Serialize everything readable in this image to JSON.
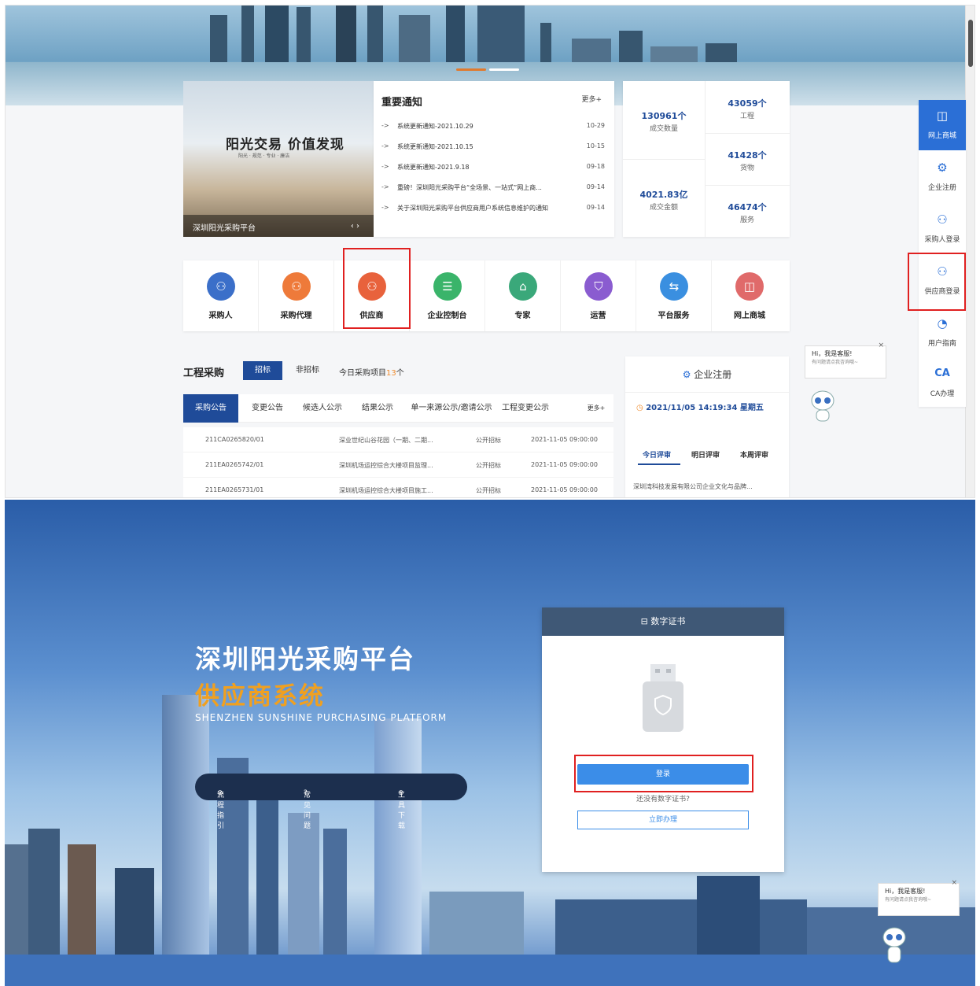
{
  "banner": {
    "dots": [
      "#e07a2e",
      "#ffffff"
    ]
  },
  "slide": {
    "title": "阳光交易 价值发现",
    "subtitle": "阳光 · 规范 · 专业 · 廉洁",
    "caption": "深圳阳光采购平台",
    "nav": "‹ ›"
  },
  "notice": {
    "title": "重要通知",
    "more": "更多+",
    "items": [
      {
        "arrow": "->",
        "text": "系统更新通知-2021.10.29",
        "date": "10-29"
      },
      {
        "arrow": "->",
        "text": "系统更新通知-2021.10.15",
        "date": "10-15"
      },
      {
        "arrow": "->",
        "text": "系统更新通知-2021.9.18",
        "date": "09-18"
      },
      {
        "arrow": "->",
        "text": "重磅！深圳阳光采购平台“全场景、一站式”网上商...",
        "date": "09-14"
      },
      {
        "arrow": "->",
        "text": "关于深圳阳光采购平台供应商用户系统信息维护的通知",
        "date": "09-14"
      }
    ]
  },
  "stats": {
    "deals": {
      "value": "130961个",
      "label": "成交数量"
    },
    "amount": {
      "value": "4021.83亿",
      "label": "成交金额"
    },
    "projects": {
      "value": "43059个",
      "label": "工程"
    },
    "goods": {
      "value": "41428个",
      "label": "货物"
    },
    "services": {
      "value": "46474个",
      "label": "服务"
    }
  },
  "quick": [
    {
      "label": "采购人",
      "color": "#3b6fc9",
      "glyph": "⚇"
    },
    {
      "label": "采购代理",
      "color": "#ee7a3a",
      "glyph": "⚇"
    },
    {
      "label": "供应商",
      "color": "#e8623c",
      "glyph": "⚇"
    },
    {
      "label": "企业控制台",
      "color": "#3ab46a",
      "glyph": "☰"
    },
    {
      "label": "专家",
      "color": "#3aa87a",
      "glyph": "⌂"
    },
    {
      "label": "运营",
      "color": "#8a5cd0",
      "glyph": "⛉"
    },
    {
      "label": "平台服务",
      "color": "#3a8fe0",
      "glyph": "⇆"
    },
    {
      "label": "网上商城",
      "color": "#e06a6a",
      "glyph": "◫"
    }
  ],
  "side": [
    {
      "label": "网上商城",
      "glyph": "◫"
    },
    {
      "label": "企业注册",
      "glyph": "⚙"
    },
    {
      "label": "采购人登录",
      "glyph": "⚇"
    },
    {
      "label": "供应商登录",
      "glyph": "⚇"
    },
    {
      "label": "用户指南",
      "glyph": "◔"
    },
    {
      "label": "CA办理",
      "glyph": "CA"
    }
  ],
  "gc": {
    "title": "工程采购",
    "tab1": "招标",
    "tab2": "非招标",
    "today_prefix": "今日采购项目",
    "today_count": "13",
    "today_suffix": "个",
    "tabs": [
      "采购公告",
      "变更公告",
      "候选人公示",
      "结果公示",
      "单一来源公示/邀请公示",
      "工程变更公示",
      "更多+"
    ],
    "rows": [
      {
        "code": "211CA0265820/01",
        "name": "深业世纪山谷花园（一期、二期...",
        "type": "公开招标",
        "time": "2021-11-05 09:00:00"
      },
      {
        "code": "211EA0265742/01",
        "name": "深圳机场运控综合大楼项目监理...",
        "type": "公开招标",
        "time": "2021-11-05 09:00:00"
      },
      {
        "code": "211EA0265731/01",
        "name": "深圳机场运控综合大楼项目施工...",
        "type": "公开招标",
        "time": "2021-11-05 09:00:00"
      }
    ]
  },
  "reg": {
    "title": "企业注册",
    "datetime": "2021/11/05 14:19:34 星期五",
    "tabs": [
      "今日评审",
      "明日评审",
      "本周评审"
    ],
    "news": "深圳湾科技发展有限公司企业文化与品牌..."
  },
  "chat": {
    "hi": "Hi，我是客服!",
    "sub": "有问题请点我咨询哦~",
    "close": "×"
  },
  "login_page": {
    "title": "深圳阳光采购平台",
    "subtitle": "供应商系统",
    "en": "SHENZHEN SUNSHINE PURCHASING PLATFORM",
    "links": [
      "流程指引",
      "常见问题",
      "工具下载"
    ],
    "cert_title": "数字证书",
    "login": "登录",
    "no_cert": "还没有数字证书?",
    "apply": "立即办理"
  }
}
